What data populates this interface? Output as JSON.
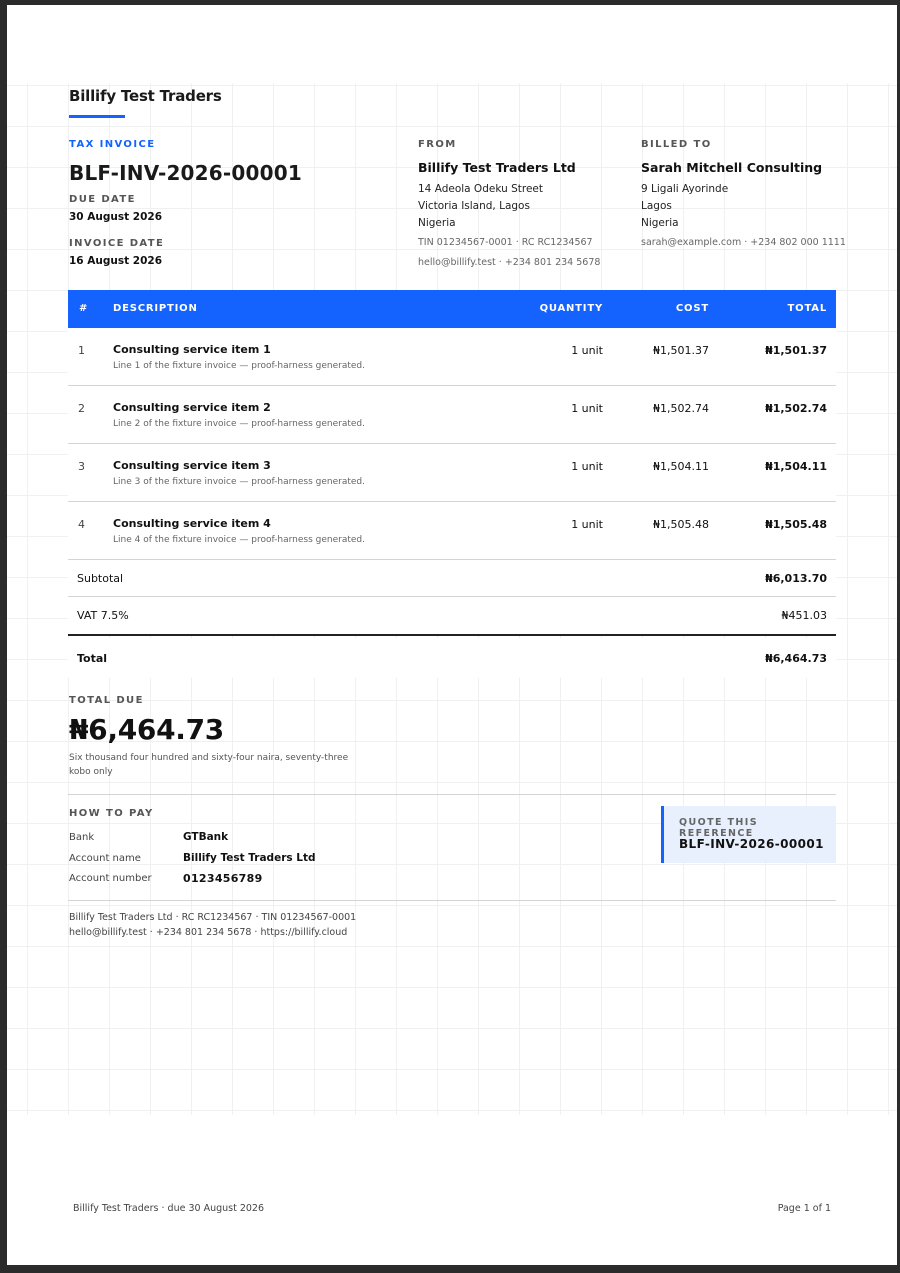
{
  "brand": "Billify Test Traders",
  "invoice": {
    "type_label": "TAX INVOICE",
    "number": "BLF-INV-2026-00001",
    "due_date_label": "DUE DATE",
    "due_date": "30 August 2026",
    "invoice_date_label": "INVOICE DATE",
    "invoice_date": "16 August 2026"
  },
  "from": {
    "label": "FROM",
    "name": "Billify Test Traders Ltd",
    "address_1": "14 Adeola Odeku Street",
    "address_2": "Victoria Island, Lagos",
    "country": "Nigeria",
    "tax_ids": "TIN 01234567-0001 · RC RC1234567",
    "contact": "hello@billify.test · +234 801 234 5678"
  },
  "billed_to": {
    "label": "BILLED TO",
    "name": "Sarah Mitchell Consulting",
    "address_1": "9 Ligali Ayorinde",
    "address_2": "Lagos",
    "country": "Nigeria",
    "contact": "sarah@example.com · +234 802 000 1111"
  },
  "table": {
    "headers": {
      "num": "#",
      "description": "DESCRIPTION",
      "quantity": "QUANTITY",
      "cost": "COST",
      "total": "TOTAL"
    },
    "rows": [
      {
        "num": "1",
        "title": "Consulting service item 1",
        "desc": "Line 1 of the fixture invoice — proof-harness generated.",
        "qty": "1 unit",
        "cost": "₦1,501.37",
        "total": "₦1,501.37"
      },
      {
        "num": "2",
        "title": "Consulting service item 2",
        "desc": "Line 2 of the fixture invoice — proof-harness generated.",
        "qty": "1 unit",
        "cost": "₦1,502.74",
        "total": "₦1,502.74"
      },
      {
        "num": "3",
        "title": "Consulting service item 3",
        "desc": "Line 3 of the fixture invoice — proof-harness generated.",
        "qty": "1 unit",
        "cost": "₦1,504.11",
        "total": "₦1,504.11"
      },
      {
        "num": "4",
        "title": "Consulting service item 4",
        "desc": "Line 4 of the fixture invoice — proof-harness generated.",
        "qty": "1 unit",
        "cost": "₦1,505.48",
        "total": "₦1,505.48"
      }
    ]
  },
  "summary": {
    "subtotal_label": "Subtotal",
    "subtotal": "₦6,013.70",
    "vat_label": "VAT 7.5%",
    "vat": "₦451.03",
    "total_label": "Total",
    "total": "₦6,464.73"
  },
  "total_due": {
    "label": "TOTAL DUE",
    "amount": "₦6,464.73",
    "words": "Six thousand four hundred and sixty-four naira, seventy-three kobo only"
  },
  "payment": {
    "label": "HOW TO PAY",
    "bank_key": "Bank",
    "bank": "GTBank",
    "account_name_key": "Account name",
    "account_name": "Billify Test Traders Ltd",
    "account_number_key": "Account number",
    "account_number": "0123456789"
  },
  "reference": {
    "label": "QUOTE THIS REFERENCE",
    "value": "BLF-INV-2026-00001"
  },
  "footer_info": {
    "line_1": "Billify Test Traders Ltd · RC RC1234567 · TIN 01234567-0001",
    "line_2": "hello@billify.test · +234 801 234 5678 · https://billify.cloud"
  },
  "page_footer": {
    "left": "Billify Test Traders · due 30 August 2026",
    "right": "Page 1 of 1"
  },
  "colors": {
    "accent": "#1463ff",
    "ref_box_bg": "#e9f0fd"
  }
}
